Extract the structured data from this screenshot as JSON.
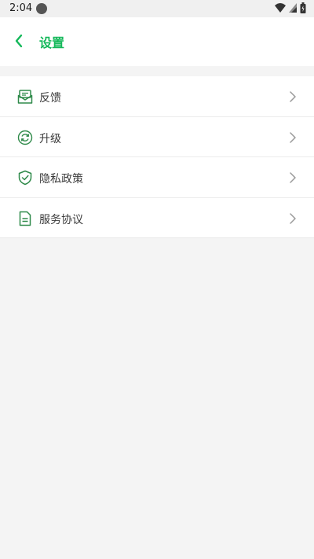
{
  "status_bar": {
    "time": "2:04"
  },
  "header": {
    "title": "设置",
    "back_icon": "chevron-left-icon"
  },
  "menu": {
    "items": [
      {
        "label": "反馈",
        "icon": "feedback-icon"
      },
      {
        "label": "升级",
        "icon": "refresh-icon"
      },
      {
        "label": "隐私政策",
        "icon": "shield-check-icon"
      },
      {
        "label": "服务协议",
        "icon": "document-icon"
      }
    ]
  },
  "colors": {
    "accent": "#14b85a",
    "icon_green": "#2f8a4a",
    "background": "#f4f4f4"
  }
}
